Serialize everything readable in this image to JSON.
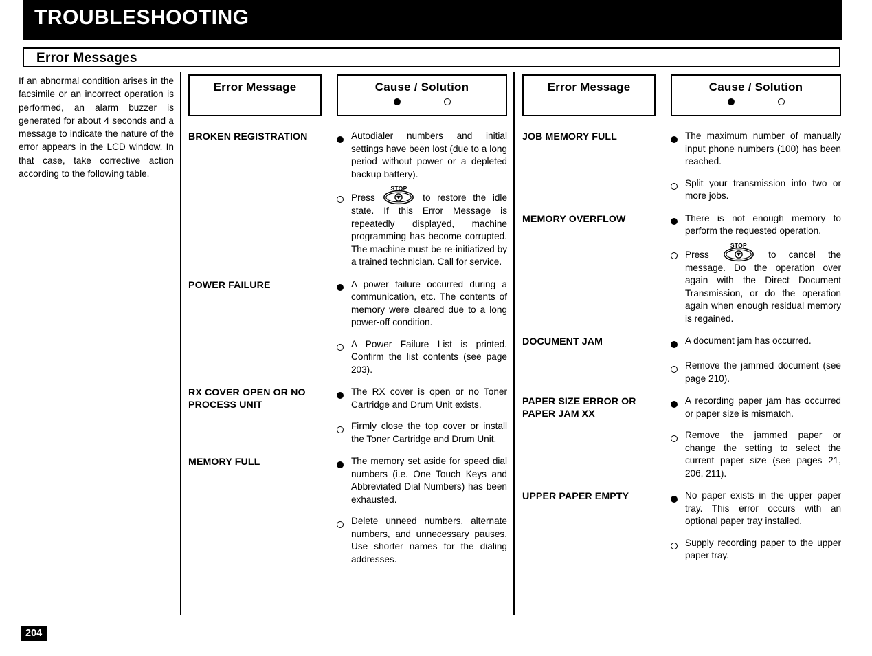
{
  "chapter": {
    "title": "TROUBLESHOOTING"
  },
  "section": {
    "title": "Error  Messages"
  },
  "intro": {
    "text": "If an abnormal condition arises in the facsimile or an incorrect operation is performed, an alarm buzzer is generated for about 4 seconds and a message to indicate the nature of the error appears in the LCD window. In that case, take corrective action according to the following table."
  },
  "icons": {
    "cause_marker": "filled-circle-icon",
    "solution_marker": "open-circle-icon",
    "stop_key": "stop-key-icon",
    "stop_key_caption": "STOP"
  },
  "tables": [
    {
      "headers": {
        "message": "Error Message",
        "solution": "Cause / Solution"
      },
      "rows": [
        {
          "message": "BROKEN REGISTRATION",
          "items": [
            {
              "marker": "filled",
              "text": "Autodialer numbers and initial settings have been lost (due to a long period without power or a depleted backup battery)."
            },
            {
              "marker": "open",
              "has_stop_key": true,
              "text_before": "Press",
              "text_after": "to restore the idle state. If this Error Message is repeatedly displayed, machine programming has become corrupted. The machine must be re-initiatized by a trained technician. Call for service."
            }
          ]
        },
        {
          "message": "POWER FAILURE",
          "items": [
            {
              "marker": "filled",
              "text": "A power failure occurred during a communication, etc. The contents of memory were cleared due to a long power-off condition."
            },
            {
              "marker": "open",
              "text": "A Power Failure List is printed. Confirm the list contents (see page 203)."
            }
          ]
        },
        {
          "message": "RX COVER OPEN  OR  NO PROCESS  UNIT",
          "items": [
            {
              "marker": "filled",
              "text": "The RX cover is open or no Toner Cartridge and Drum Unit exists."
            },
            {
              "marker": "open",
              "text": "Firmly close the top cover or install the Toner Cartridge and Drum Unit."
            }
          ]
        },
        {
          "message": "MEMORY  FULL",
          "items": [
            {
              "marker": "filled",
              "text": "The memory set aside for speed dial numbers (i.e. One Touch Keys and Abbreviated Dial Numbers) has been exhausted."
            },
            {
              "marker": "open",
              "text": "Delete unneed numbers, alternate numbers, and unnecessary pauses. Use shorter names for the dialing addresses."
            }
          ]
        }
      ]
    },
    {
      "headers": {
        "message": "Error Message",
        "solution": "Cause / Solution"
      },
      "rows": [
        {
          "message": "JOB MEMORY FULL",
          "items": [
            {
              "marker": "filled",
              "text": "The maximum number of manually input phone numbers (100) has been reached."
            },
            {
              "marker": "open",
              "text": "Split your transmission into two or more jobs."
            }
          ]
        },
        {
          "message": "MEMORY OVERFLOW",
          "items": [
            {
              "marker": "filled",
              "text": "There is not enough memory to perform the requested operation."
            },
            {
              "marker": "open",
              "has_stop_key": true,
              "text_before": "Press",
              "text_after": "to cancel the message. Do the operation over again with the Direct Document Transmission, or do the operation again when enough residual memory is regained."
            }
          ]
        },
        {
          "message": "DOCUMENT JAM",
          "items": [
            {
              "marker": "filled",
              "text": "A document jam has occurred."
            },
            {
              "marker": "open",
              "text": "Remove the jammed document (see page 210)."
            }
          ]
        },
        {
          "message": "PAPER SIZE ERROR OR PAPER JAM  XX",
          "items": [
            {
              "marker": "filled",
              "text": "A recording paper jam has occurred or paper size is mismatch."
            },
            {
              "marker": "open",
              "text": "Remove the jammed paper or change the setting to select the current paper size (see pages 21, 206, 211)."
            }
          ]
        },
        {
          "message": "UPPER PAPER EMPTY",
          "items": [
            {
              "marker": "filled",
              "text": "No paper exists in the upper paper tray. This error occurs with an optional paper tray installed."
            },
            {
              "marker": "open",
              "text": "Supply recording paper to the upper paper tray."
            }
          ]
        }
      ]
    }
  ],
  "footer": {
    "page_number": "204"
  },
  "colors": {
    "ink": "#000000",
    "paper": "#ffffff"
  }
}
